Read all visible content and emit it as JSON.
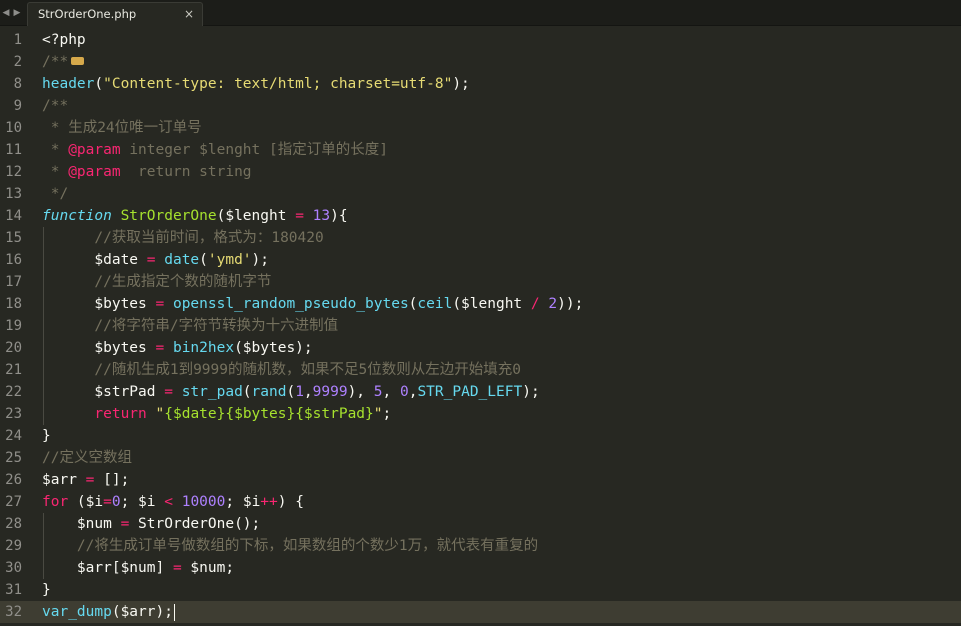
{
  "tabbar": {
    "prev_glyph": "◀",
    "next_glyph": "▶",
    "active_tab": {
      "title": "StrOrderOne.php",
      "close_glyph": "×"
    }
  },
  "theme": {
    "background": "#272822",
    "current_line": "#3e3d32",
    "comment": "#75715e",
    "function": "#66d9ef",
    "string": "#e6db74",
    "keyword": "#f92672",
    "entity": "#a6e22e",
    "number": "#ae81ff"
  },
  "editor": {
    "current_line": 32,
    "lines": [
      {
        "num": "1",
        "tokens": [
          [
            "tag",
            "<?php"
          ]
        ]
      },
      {
        "num": "2",
        "tokens": [
          [
            "comment",
            "/**"
          ]
        ],
        "folded": true
      },
      {
        "num": "8",
        "tokens": [
          [
            "func",
            "header"
          ],
          [
            "plain",
            "("
          ],
          [
            "string",
            "\"Content-type: text/html; charset=utf-8\""
          ],
          [
            "plain",
            ");"
          ]
        ]
      },
      {
        "num": "9",
        "tokens": [
          [
            "comment",
            "/**"
          ]
        ]
      },
      {
        "num": "10",
        "tokens": [
          [
            "comment",
            " * 生成24位唯一订单号"
          ]
        ]
      },
      {
        "num": "11",
        "tokens": [
          [
            "comment",
            " * "
          ],
          [
            "docparam",
            "@param"
          ],
          [
            "comment",
            " integer $lenght [指定订单的长度]"
          ]
        ]
      },
      {
        "num": "12",
        "tokens": [
          [
            "comment",
            " * "
          ],
          [
            "docparam",
            "@param"
          ],
          [
            "comment",
            "  return string"
          ]
        ]
      },
      {
        "num": "13",
        "tokens": [
          [
            "comment",
            " */"
          ]
        ]
      },
      {
        "num": "14",
        "tokens": [
          [
            "storage",
            "function"
          ],
          [
            "plain",
            " "
          ],
          [
            "entity",
            "StrOrderOne"
          ],
          [
            "plain",
            "($lenght "
          ],
          [
            "op",
            "="
          ],
          [
            "plain",
            " "
          ],
          [
            "number",
            "13"
          ],
          [
            "plain",
            "){"
          ]
        ]
      },
      {
        "num": "15",
        "tokens": [
          [
            "plain",
            "      "
          ],
          [
            "comment",
            "//获取当前时间，格式为：180420"
          ]
        ]
      },
      {
        "num": "16",
        "tokens": [
          [
            "plain",
            "      $date "
          ],
          [
            "op",
            "="
          ],
          [
            "plain",
            " "
          ],
          [
            "func",
            "date"
          ],
          [
            "plain",
            "("
          ],
          [
            "string",
            "'ymd'"
          ],
          [
            "plain",
            ");"
          ]
        ]
      },
      {
        "num": "17",
        "tokens": [
          [
            "plain",
            "      "
          ],
          [
            "comment",
            "//生成指定个数的随机字节"
          ]
        ]
      },
      {
        "num": "18",
        "tokens": [
          [
            "plain",
            "      $bytes "
          ],
          [
            "op",
            "="
          ],
          [
            "plain",
            " "
          ],
          [
            "func",
            "openssl_random_pseudo_bytes"
          ],
          [
            "plain",
            "("
          ],
          [
            "func",
            "ceil"
          ],
          [
            "plain",
            "($lenght "
          ],
          [
            "op",
            "/"
          ],
          [
            "plain",
            " "
          ],
          [
            "number",
            "2"
          ],
          [
            "plain",
            "));"
          ]
        ]
      },
      {
        "num": "19",
        "tokens": [
          [
            "plain",
            "      "
          ],
          [
            "comment",
            "//将字符串/字符节转换为十六进制值"
          ]
        ]
      },
      {
        "num": "20",
        "tokens": [
          [
            "plain",
            "      $bytes "
          ],
          [
            "op",
            "="
          ],
          [
            "plain",
            " "
          ],
          [
            "func",
            "bin2hex"
          ],
          [
            "plain",
            "($bytes);"
          ]
        ]
      },
      {
        "num": "21",
        "tokens": [
          [
            "plain",
            "      "
          ],
          [
            "comment",
            "//随机生成1到9999的随机数，如果不足5位数则从左边开始填充0"
          ]
        ]
      },
      {
        "num": "22",
        "tokens": [
          [
            "plain",
            "      $strPad "
          ],
          [
            "op",
            "="
          ],
          [
            "plain",
            " "
          ],
          [
            "func",
            "str_pad"
          ],
          [
            "plain",
            "("
          ],
          [
            "func",
            "rand"
          ],
          [
            "plain",
            "("
          ],
          [
            "number",
            "1"
          ],
          [
            "plain",
            ","
          ],
          [
            "number",
            "9999"
          ],
          [
            "plain",
            "), "
          ],
          [
            "number",
            "5"
          ],
          [
            "plain",
            ", "
          ],
          [
            "number",
            "0"
          ],
          [
            "plain",
            ","
          ],
          [
            "const",
            "STR_PAD_LEFT"
          ],
          [
            "plain",
            ");"
          ]
        ]
      },
      {
        "num": "23",
        "tokens": [
          [
            "plain",
            "      "
          ],
          [
            "keyword",
            "return"
          ],
          [
            "plain",
            " "
          ],
          [
            "string",
            "\""
          ],
          [
            "interp",
            "{$date}{$bytes}{$strPad}"
          ],
          [
            "string",
            "\""
          ],
          [
            "plain",
            ";"
          ]
        ]
      },
      {
        "num": "24",
        "tokens": [
          [
            "plain",
            "}"
          ]
        ]
      },
      {
        "num": "25",
        "tokens": [
          [
            "comment",
            "//定义空数组"
          ]
        ]
      },
      {
        "num": "26",
        "tokens": [
          [
            "plain",
            "$arr "
          ],
          [
            "op",
            "="
          ],
          [
            "plain",
            " [];"
          ]
        ]
      },
      {
        "num": "27",
        "tokens": [
          [
            "keyword",
            "for"
          ],
          [
            "plain",
            " ($i"
          ],
          [
            "op",
            "="
          ],
          [
            "number",
            "0"
          ],
          [
            "plain",
            "; $i "
          ],
          [
            "op",
            "<"
          ],
          [
            "plain",
            " "
          ],
          [
            "number",
            "10000"
          ],
          [
            "plain",
            "; $i"
          ],
          [
            "op",
            "++"
          ],
          [
            "plain",
            ") {"
          ]
        ]
      },
      {
        "num": "28",
        "tokens": [
          [
            "plain",
            "    $num "
          ],
          [
            "op",
            "="
          ],
          [
            "plain",
            " StrOrderOne();"
          ]
        ]
      },
      {
        "num": "29",
        "tokens": [
          [
            "plain",
            "    "
          ],
          [
            "comment",
            "//将生成订单号做数组的下标，如果数组的个数少1万，就代表有重复的"
          ]
        ]
      },
      {
        "num": "30",
        "tokens": [
          [
            "plain",
            "    $arr[$num] "
          ],
          [
            "op",
            "="
          ],
          [
            "plain",
            " $num;"
          ]
        ]
      },
      {
        "num": "31",
        "tokens": [
          [
            "plain",
            "}"
          ]
        ]
      },
      {
        "num": "32",
        "tokens": [
          [
            "func",
            "var_dump"
          ],
          [
            "plain",
            "($arr);"
          ]
        ],
        "caret": true
      }
    ]
  }
}
